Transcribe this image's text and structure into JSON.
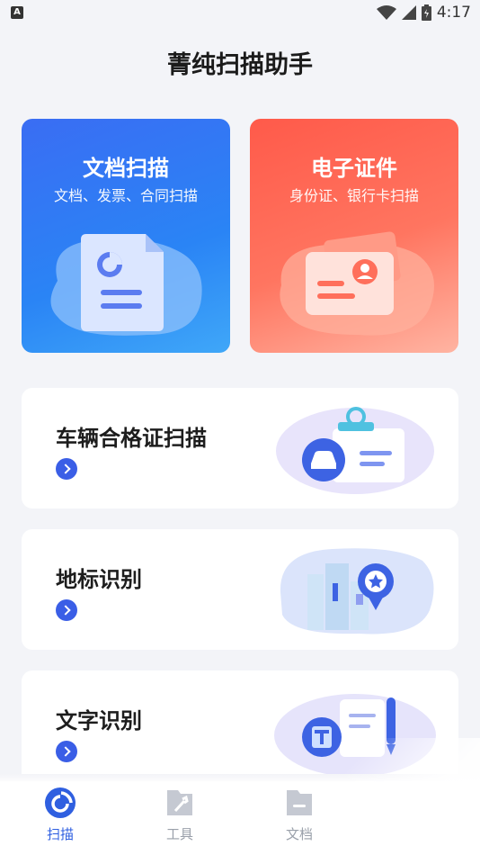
{
  "status": {
    "indicator": "A",
    "time": "4:17"
  },
  "app": {
    "title": "菁纯扫描助手"
  },
  "big_cards": [
    {
      "title": "文档扫描",
      "subtitle": "文档、发票、合同扫描",
      "icon": "document-icon"
    },
    {
      "title": "电子证件",
      "subtitle": "身份证、银行卡扫描",
      "icon": "id-card-icon"
    }
  ],
  "rows": [
    {
      "title": "车辆合格证扫描",
      "icon": "car-certificate-icon"
    },
    {
      "title": "地标识别",
      "icon": "landmark-icon"
    },
    {
      "title": "文字识别",
      "icon": "text-recognition-icon"
    }
  ],
  "tabs": [
    {
      "label": "扫描",
      "icon": "scan-icon",
      "active": true
    },
    {
      "label": "工具",
      "icon": "tools-icon",
      "active": false
    },
    {
      "label": "文档",
      "icon": "folder-icon",
      "active": false
    }
  ],
  "colors": {
    "accent": "#2f5fe0",
    "doc_card": "#3a6df3",
    "id_card": "#ff5a4a",
    "inactive": "#9aa0aa"
  }
}
